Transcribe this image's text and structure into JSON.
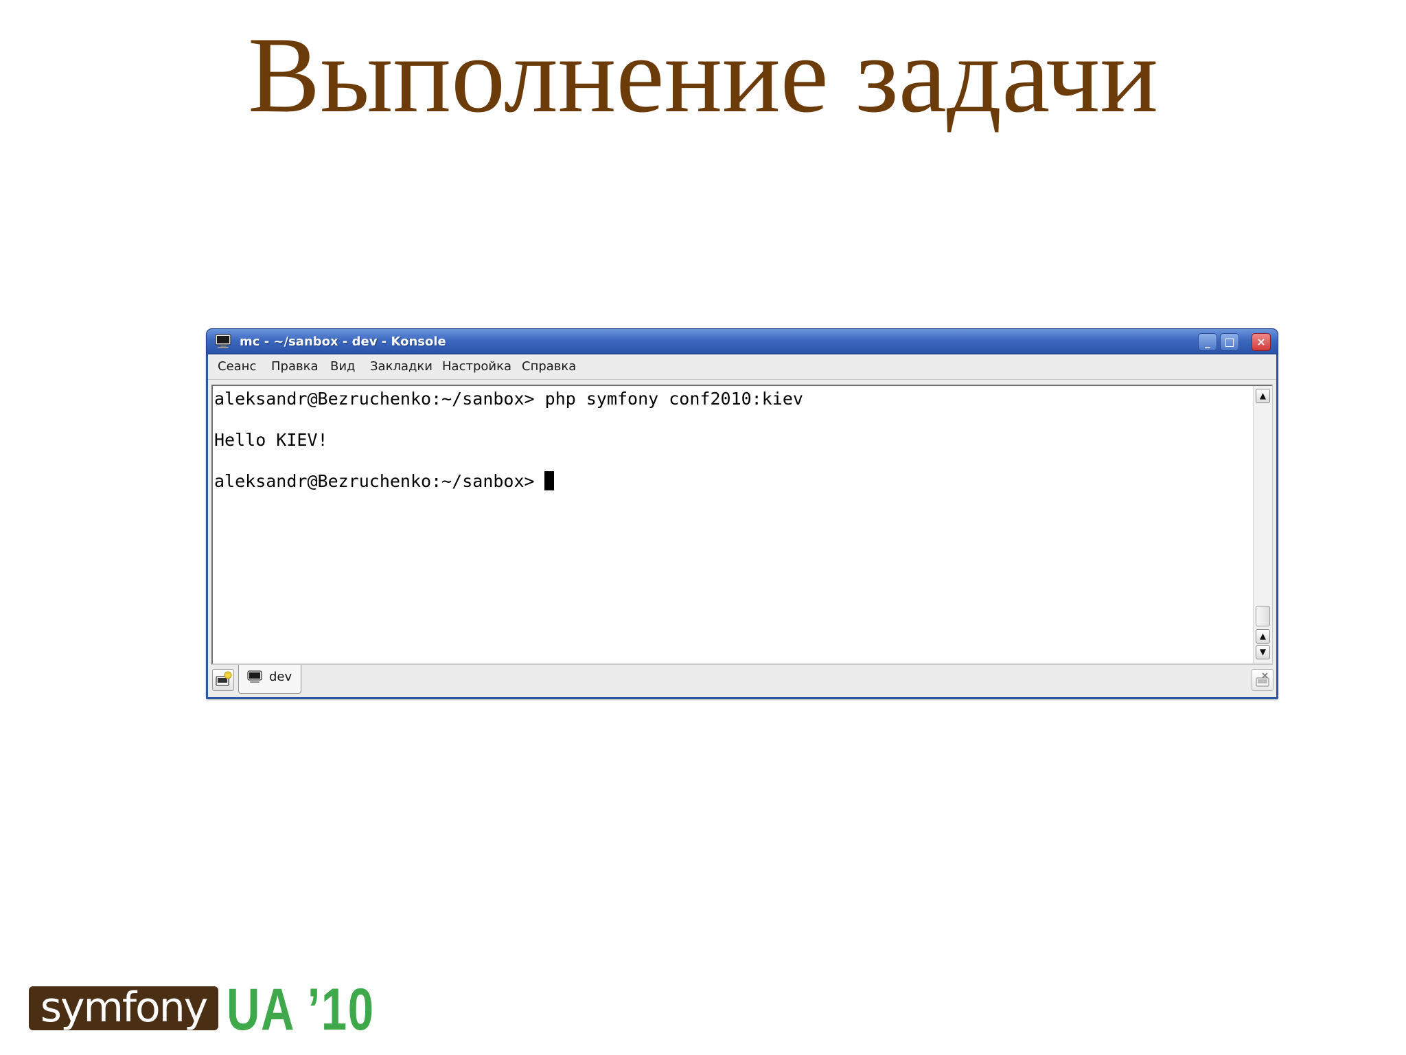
{
  "slide": {
    "title": "Выполнение задачи"
  },
  "window": {
    "title": "mc - ~/sanbox - dev - Konsole",
    "icon": "terminal-icon",
    "buttons": {
      "minimize": "_",
      "maximize": "□",
      "close": "×"
    },
    "menu": [
      {
        "label": "Сеанс"
      },
      {
        "label": "Правка"
      },
      {
        "label": "Вид"
      },
      {
        "label": "Закладки"
      },
      {
        "label": "Настройка"
      },
      {
        "label": "Справка"
      }
    ]
  },
  "terminal": {
    "lines": [
      "aleksandr@Bezruchenko:~/sanbox> php symfony conf2010:kiev",
      "Hello KIEV!",
      "aleksandr@Bezruchenko:~/sanbox>"
    ],
    "scroll": {
      "up": "▲",
      "down": "▼"
    }
  },
  "tabs": [
    {
      "label": "dev",
      "icon": "terminal-icon"
    }
  ],
  "logo": {
    "symfony": "symfony",
    "event": "UA ’10",
    "colors": {
      "symfony_bg": "#4a2f14",
      "event_text": "#3ea84a"
    }
  },
  "colors": {
    "title": "#6b3b0a",
    "titlebar": "#3d69c0",
    "close_button": "#d23a3a"
  }
}
